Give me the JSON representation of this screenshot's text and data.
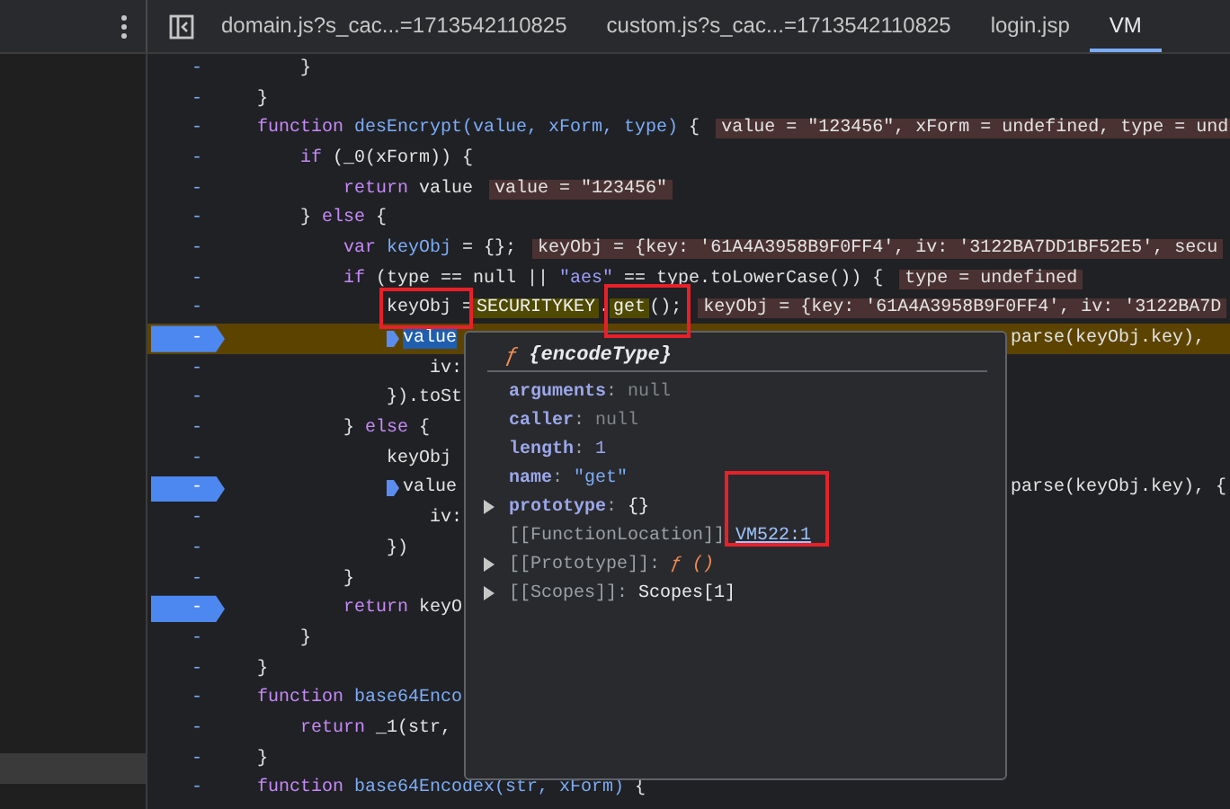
{
  "tabs": [
    {
      "label": "domain.js?s_cac...=1713542110825",
      "selected": false
    },
    {
      "label": "custom.js?s_cac...=1713542110825",
      "selected": false
    },
    {
      "label": "login.jsp",
      "selected": false
    },
    {
      "label": "VM",
      "selected": true
    }
  ],
  "code": {
    "lines": [
      {
        "children": [
          {
            "gutter": "-",
            "breakpoint": false,
            "paused": false,
            "segments": [
              {
                "kind": "plain",
                "text": "}"
              }
            ]
          }
        ]
      },
      {
        "gutter": "-",
        "breakpoint": false,
        "paused": false,
        "segments": [
          {
            "kind": "plain",
            "text": "}"
          }
        ]
      },
      {
        "gutter": "-",
        "breakpoint": false,
        "paused": false,
        "segments": [
          {
            "kind": "kw",
            "text": "function"
          },
          {
            "kind": "fn",
            "text": "desEncrypt(value, xForm, type)"
          },
          {
            "kind": "plain",
            "text": "{"
          },
          {
            "kind": "val",
            "text": "value = \"123456\", xForm = undefined, type = und"
          }
        ],
        "children": [
          {
            "gutter": "-",
            "breakpoint": false,
            "paused": false,
            "segments": [
              {
                "kind": "kw",
                "text": "if"
              },
              {
                "kind": "plain",
                "text": "(_0(xForm)) {"
              }
            ],
            "children": [
              {
                "gutter": "-",
                "breakpoint": false,
                "paused": false,
                "segments": [
                  {
                    "kind": "kw",
                    "text": "return"
                  },
                  {
                    "kind": "plain",
                    "text": "value"
                  },
                  {
                    "kind": "val",
                    "text": "value = \"123456\""
                  }
                ]
              }
            ]
          },
          {
            "gutter": "-",
            "breakpoint": false,
            "paused": false,
            "segments": [
              {
                "kind": "plain",
                "text": "}"
              },
              {
                "kind": "kw",
                "text": "else"
              },
              {
                "kind": "plain",
                "text": "{"
              }
            ],
            "children": [
              {
                "gutter": "-",
                "breakpoint": false,
                "paused": false,
                "segments": [
                  {
                    "kind": "kw",
                    "text": "var"
                  },
                  {
                    "kind": "fn",
                    "text": "keyObj"
                  },
                  {
                    "kind": "plain",
                    "text": "= {};"
                  },
                  {
                    "kind": "val",
                    "text": "keyObj = {key: '61A4A3958B9F0FF4', iv: '3122BA7DD1BF52E5', secu"
                  }
                ]
              },
              {
                "gutter": "-",
                "breakpoint": false,
                "paused": false,
                "segments": [
                  {
                    "kind": "kw",
                    "text": "if"
                  },
                  {
                    "kind": "plain",
                    "text": "(type == null ||"
                  },
                  {
                    "kind": "str",
                    "text": "\"aes\""
                  },
                  {
                    "kind": "plain",
                    "text": "== type.toLowerCase()) {"
                  },
                  {
                    "kind": "val",
                    "text": "type = undefined"
                  }
                ],
                "children": [
                  {
                    "gutter": "-",
                    "breakpoint": false,
                    "paused": false,
                    "segments": [
                      {
                        "kind": "plain",
                        "text": "keyObj ="
                      },
                      {
                        "kind": "hover",
                        "text": "SECURITYKEY"
                      },
                      {
                        "kind": "plain",
                        "text": "."
                      },
                      {
                        "kind": "hover",
                        "text": "get"
                      },
                      {
                        "kind": "plain",
                        "text": "();"
                      },
                      {
                        "kind": "val",
                        "text": "keyObj = {key: '61A4A3958B9F0FF4', iv: '3122BA7D"
                      }
                    ]
                  },
                  {
                    "gutter": "-",
                    "breakpoint": true,
                    "paused": true,
                    "marker": true,
                    "segments": [
                      {
                        "kind": "sel",
                        "text": "value"
                      }
                    ],
                    "right": [
                      {
                        "kind": "plain",
                        "text": "parse(keyObj.key),"
                      }
                    ],
                    "children": [
                      {
                        "gutter": "-",
                        "breakpoint": false,
                        "paused": false,
                        "segments": [
                          {
                            "kind": "plain",
                            "text": "iv:"
                          }
                        ]
                      }
                    ]
                  },
                  {
                    "gutter": "-",
                    "breakpoint": false,
                    "paused": false,
                    "segments": [
                      {
                        "kind": "plain",
                        "text": "}).toSt"
                      }
                    ]
                  }
                ]
              },
              {
                "gutter": "-",
                "breakpoint": false,
                "paused": false,
                "segments": [
                  {
                    "kind": "plain",
                    "text": "}"
                  },
                  {
                    "kind": "kw",
                    "text": "else"
                  },
                  {
                    "kind": "plain",
                    "text": "{"
                  }
                ],
                "children": [
                  {
                    "gutter": "-",
                    "breakpoint": false,
                    "paused": false,
                    "segments": [
                      {
                        "kind": "plain",
                        "text": "keyObj"
                      }
                    ]
                  },
                  {
                    "gutter": "-",
                    "breakpoint": true,
                    "paused": false,
                    "marker": true,
                    "segments": [
                      {
                        "kind": "plain",
                        "text": "value"
                      }
                    ],
                    "right": [
                      {
                        "kind": "plain",
                        "text": "parse(keyObj.key), {"
                      }
                    ],
                    "children": [
                      {
                        "gutter": "-",
                        "breakpoint": false,
                        "paused": false,
                        "segments": [
                          {
                            "kind": "plain",
                            "text": "iv:"
                          }
                        ]
                      }
                    ]
                  },
                  {
                    "gutter": "-",
                    "breakpoint": false,
                    "paused": false,
                    "segments": [
                      {
                        "kind": "plain",
                        "text": "})"
                      }
                    ]
                  }
                ]
              },
              {
                "gutter": "-",
                "breakpoint": false,
                "paused": false,
                "segments": [
                  {
                    "kind": "plain",
                    "text": "}"
                  }
                ]
              },
              {
                "gutter": "-",
                "breakpoint": true,
                "paused": false,
                "segments": [
                  {
                    "kind": "kw",
                    "text": "return"
                  },
                  {
                    "kind": "plain",
                    "text": "keyO"
                  }
                ]
              }
            ]
          },
          {
            "gutter": "-",
            "breakpoint": false,
            "paused": false,
            "segments": [
              {
                "kind": "plain",
                "text": "}"
              }
            ]
          }
        ]
      },
      {
        "gutter": "-",
        "breakpoint": false,
        "paused": false,
        "segments": [
          {
            "kind": "plain",
            "text": "}"
          }
        ]
      },
      {
        "gutter": "-",
        "breakpoint": false,
        "paused": false,
        "segments": [
          {
            "kind": "kw",
            "text": "function"
          },
          {
            "kind": "fn",
            "text": "base64Enco"
          }
        ],
        "children": [
          {
            "gutter": "-",
            "breakpoint": false,
            "paused": false,
            "segments": [
              {
                "kind": "kw",
                "text": "return"
              },
              {
                "kind": "plain",
                "text": "_1(str,"
              }
            ]
          }
        ]
      },
      {
        "gutter": "-",
        "breakpoint": false,
        "paused": false,
        "segments": [
          {
            "kind": "plain",
            "text": "}"
          }
        ]
      },
      {
        "gutter": "-",
        "breakpoint": false,
        "paused": false,
        "segments": [
          {
            "kind": "kw",
            "text": "function"
          },
          {
            "kind": "fn",
            "text": "base64Encodex(str, xForm)"
          },
          {
            "kind": "plain",
            "text": "{"
          }
        ]
      }
    ]
  },
  "popover": {
    "glyph": "ƒ",
    "title": "{encodeType}",
    "properties": [
      {
        "name": "arguments",
        "sep": ":",
        "value": "null",
        "kind": "null",
        "expandable": false
      },
      {
        "name": "caller",
        "sep": ":",
        "value": "null",
        "kind": "null",
        "expandable": false
      },
      {
        "name": "length",
        "sep": ":",
        "value": "1",
        "kind": "number",
        "expandable": false
      },
      {
        "name": "name",
        "sep": ":",
        "value": "\"get\"",
        "kind": "string",
        "expandable": false
      },
      {
        "name": "prototype",
        "sep": ":",
        "value": "{}",
        "kind": "object",
        "expandable": true
      },
      {
        "name": "[[FunctionLocation]]",
        "value": "VM522:1",
        "kind": "link",
        "expandable": false
      },
      {
        "name": "[[Prototype]]",
        "sep": ":",
        "value": "ƒ ()",
        "kind": "func",
        "expandable": true
      },
      {
        "name": "[[Scopes]]",
        "sep": ":",
        "value": "Scopes[1]",
        "kind": "internal",
        "expandable": true
      }
    ]
  }
}
